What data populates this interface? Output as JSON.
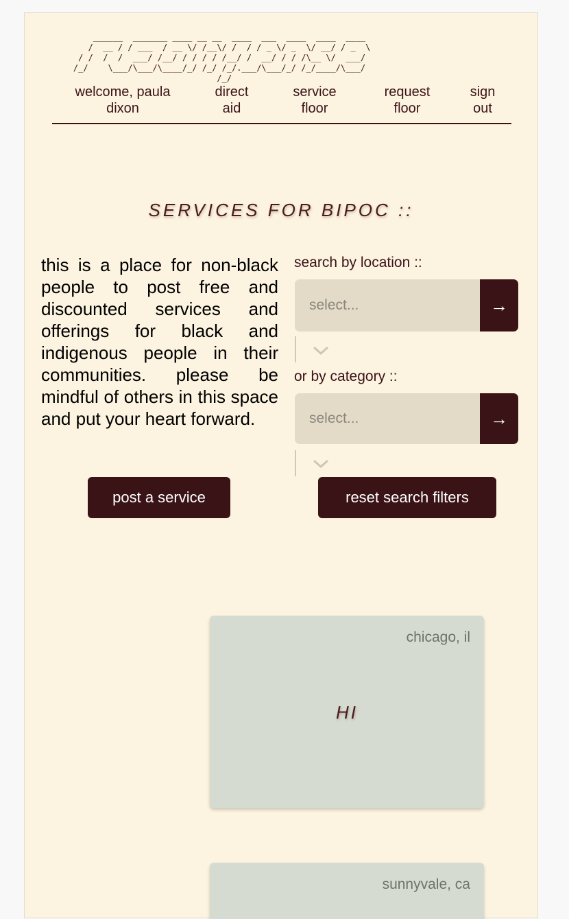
{
  "header": {
    "logo_text": "reconvene",
    "logo_ascii": "        ______  _______ ____ __ __  ____  ___  ____  ____  ____\n       /  __ / / ___  / __ \\/ /__\\/ /  / / _ \\/ _  \\/ __/ / _  \\\n     / /  /  /  ___/ /__/ / / / / /__/ /  __/ / / /\\__ \\/  ___/\n    /_/    \\___/\\___/\\____/_/ /_/ /_/.___/\\___/_/ /_/____/\\___/\n                                 /_/",
    "nav": {
      "welcome": "welcome, paula dixon",
      "direct_aid": "direct aid",
      "service_floor": "service floor",
      "request_floor": "request floor",
      "sign_out": "sign out"
    }
  },
  "main": {
    "title": "SERVICES FOR BIPOC ::",
    "intro": "this is a place for non-black people to post free and discounted services and offerings for black and indigenous people in their communities. please be mindful of others in this space and put your heart forward.",
    "filters": {
      "location_label": "search by location ::",
      "location_placeholder": "select...",
      "category_label": "or by category ::",
      "category_placeholder": "select...",
      "go_icon": "→"
    },
    "buttons": {
      "post": "post a service",
      "reset": "reset search filters"
    }
  },
  "cards": [
    {
      "location": "chicago, il",
      "title": "HI"
    },
    {
      "location": "sunnyvale, ca",
      "title": ""
    }
  ],
  "colors": {
    "page_background": "#fcf3e0",
    "accent": "#3a1317",
    "card_background": "#d5dbd1",
    "select_background": "#e3dbc8"
  }
}
